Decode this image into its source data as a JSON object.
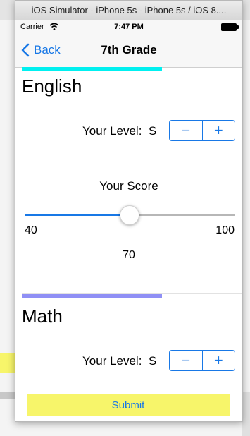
{
  "window": {
    "title": "iOS Simulator - iPhone 5s - iPhone 5s / iOS 8...."
  },
  "status_bar": {
    "carrier": "Carrier",
    "time": "7:47 PM"
  },
  "nav": {
    "back_label": "Back",
    "title": "7th Grade"
  },
  "sections": [
    {
      "title": "English",
      "accent_color": "#00f0f0",
      "level_label": "Your Level:",
      "level_value": "S",
      "score_label": "Your Score",
      "slider_min": "40",
      "slider_max": "100",
      "score_value": "70",
      "slider_fraction": 0.5
    },
    {
      "title": "Math",
      "accent_color": "#8f8ff5",
      "level_label": "Your Level:",
      "level_value": "S"
    }
  ],
  "stepper": {
    "minus": "−",
    "plus": "+"
  },
  "submit_label": "Submit",
  "colors": {
    "tint": "#1878e6",
    "submit_bg": "#f7f56a"
  }
}
